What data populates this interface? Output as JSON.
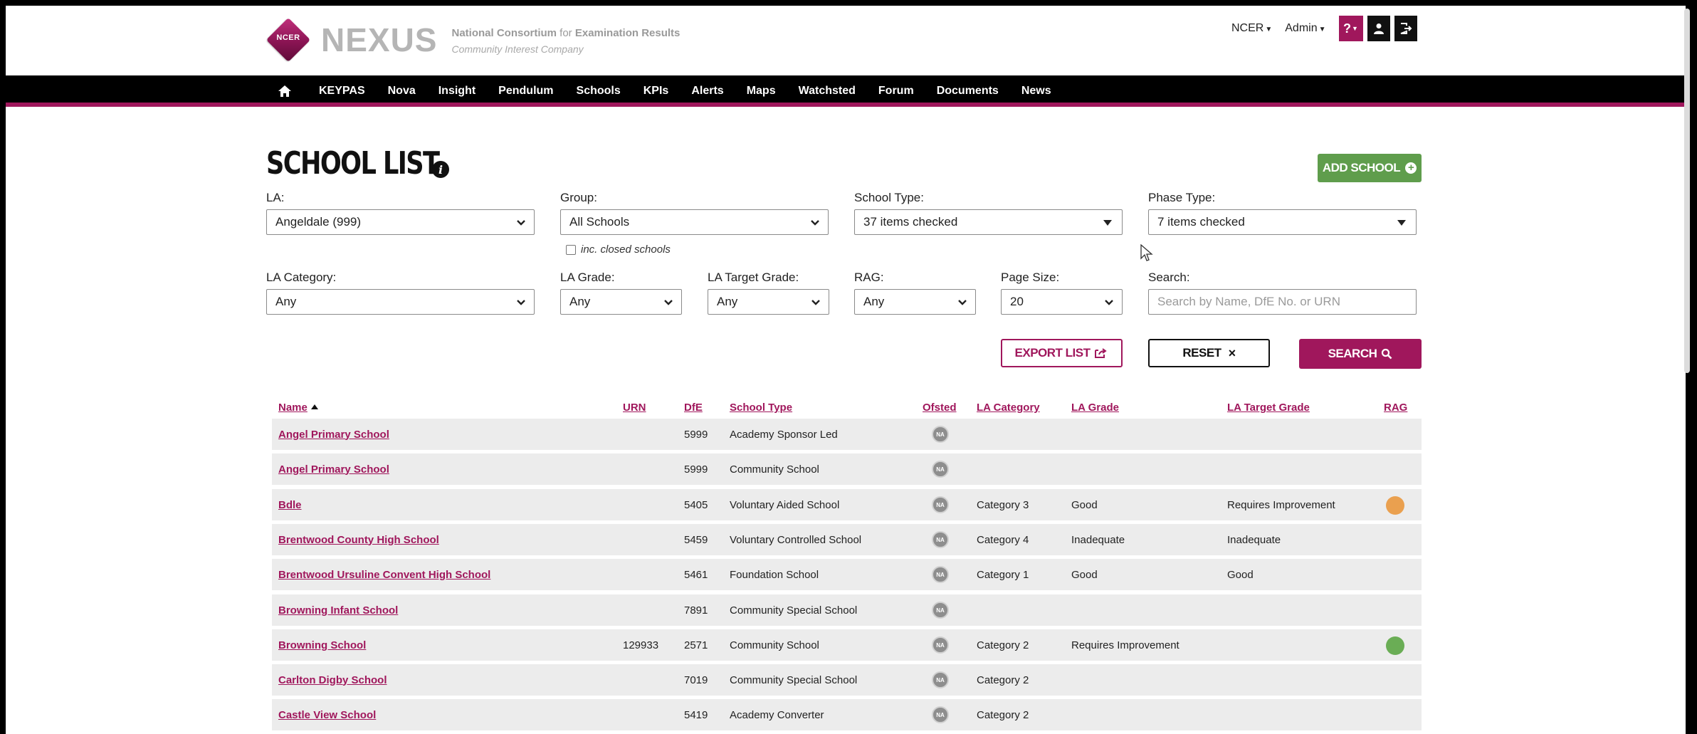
{
  "brand": {
    "logo_badge": "NCER",
    "logo_name": "NEXUS",
    "tagline_part1": "National Consortium",
    "tagline_for": "for",
    "tagline_part2": "Examination Results",
    "tagline_line2": "Community Interest Company"
  },
  "topbar": {
    "org_menu": "NCER",
    "user_menu": "Admin",
    "help_icon": "question-icon",
    "profile_icon": "user-icon",
    "logout_icon": "logout-icon"
  },
  "nav": {
    "home_icon": "home-icon",
    "items": [
      "KEYPAS",
      "Nova",
      "Insight",
      "Pendulum",
      "Schools",
      "KPIs",
      "Alerts",
      "Maps",
      "Watchsted",
      "Forum",
      "Documents",
      "News"
    ]
  },
  "page": {
    "title": "SCHOOL LIST",
    "add_button": "ADD SCHOOL"
  },
  "filters": {
    "la": {
      "label": "LA:",
      "value": "Angeldale (999)"
    },
    "group": {
      "label": "Group:",
      "value": "All Schools"
    },
    "inc_closed": {
      "label": "inc. closed schools",
      "checked": false
    },
    "school_type": {
      "label": "School Type:",
      "value": "37 items checked"
    },
    "phase_type": {
      "label": "Phase Type:",
      "value": "7 items checked"
    },
    "la_category": {
      "label": "LA Category:",
      "value": "Any"
    },
    "la_grade": {
      "label": "LA Grade:",
      "value": "Any"
    },
    "la_target_grade": {
      "label": "LA Target Grade:",
      "value": "Any"
    },
    "rag": {
      "label": "RAG:",
      "value": "Any"
    },
    "page_size": {
      "label": "Page Size:",
      "value": "20"
    },
    "search": {
      "label": "Search:",
      "placeholder": "Search by Name, DfE No. or URN",
      "value": ""
    }
  },
  "actions": {
    "export": "EXPORT LIST",
    "reset": "RESET",
    "reset_icon": "×",
    "search": "SEARCH"
  },
  "table": {
    "columns": [
      "Name",
      "URN",
      "DfE",
      "School Type",
      "Ofsted",
      "LA Category",
      "LA Grade",
      "LA Target Grade",
      "RAG"
    ],
    "sorted_by": "Name",
    "rows": [
      {
        "name": "Angel Primary School",
        "urn": "",
        "dfe": "5999",
        "type": "Academy Sponsor Led",
        "ofsted": "NA",
        "category": "",
        "grade": "",
        "target": "",
        "rag": ""
      },
      {
        "name": "Angel Primary School",
        "urn": "",
        "dfe": "5999",
        "type": "Community School",
        "ofsted": "NA",
        "category": "",
        "grade": "",
        "target": "",
        "rag": ""
      },
      {
        "name": "Bdle",
        "urn": "",
        "dfe": "5405",
        "type": "Voluntary Aided School",
        "ofsted": "NA",
        "category": "Category 3",
        "grade": "Good",
        "target": "Requires Improvement",
        "rag": "#eaa04f"
      },
      {
        "name": "Brentwood County High School",
        "urn": "",
        "dfe": "5459",
        "type": "Voluntary Controlled School",
        "ofsted": "NA",
        "category": "Category 4",
        "grade": "Inadequate",
        "target": "Inadequate",
        "rag": ""
      },
      {
        "name": "Brentwood Ursuline Convent High School",
        "urn": "",
        "dfe": "5461",
        "type": "Foundation School",
        "ofsted": "NA",
        "category": "Category 1",
        "grade": "Good",
        "target": "Good",
        "rag": ""
      },
      {
        "name": "Browning Infant School",
        "urn": "",
        "dfe": "7891",
        "type": "Community Special School",
        "ofsted": "NA",
        "category": "",
        "grade": "",
        "target": "",
        "rag": ""
      },
      {
        "name": "Browning School",
        "urn": "129933",
        "dfe": "2571",
        "type": "Community School",
        "ofsted": "NA",
        "category": "Category 2",
        "grade": "Requires Improvement",
        "target": "",
        "rag": "#6aad55"
      },
      {
        "name": "Carlton Digby School",
        "urn": "",
        "dfe": "7019",
        "type": "Community Special School",
        "ofsted": "NA",
        "category": "Category 2",
        "grade": "",
        "target": "",
        "rag": ""
      },
      {
        "name": "Castle View School",
        "urn": "",
        "dfe": "5419",
        "type": "Academy Converter",
        "ofsted": "NA",
        "category": "Category 2",
        "grade": "",
        "target": "",
        "rag": ""
      }
    ]
  },
  "colors": {
    "brand": "#a0175c",
    "add_green": "#5f9d4c",
    "nav_bg": "#000000",
    "row_bg": "#ececec"
  }
}
